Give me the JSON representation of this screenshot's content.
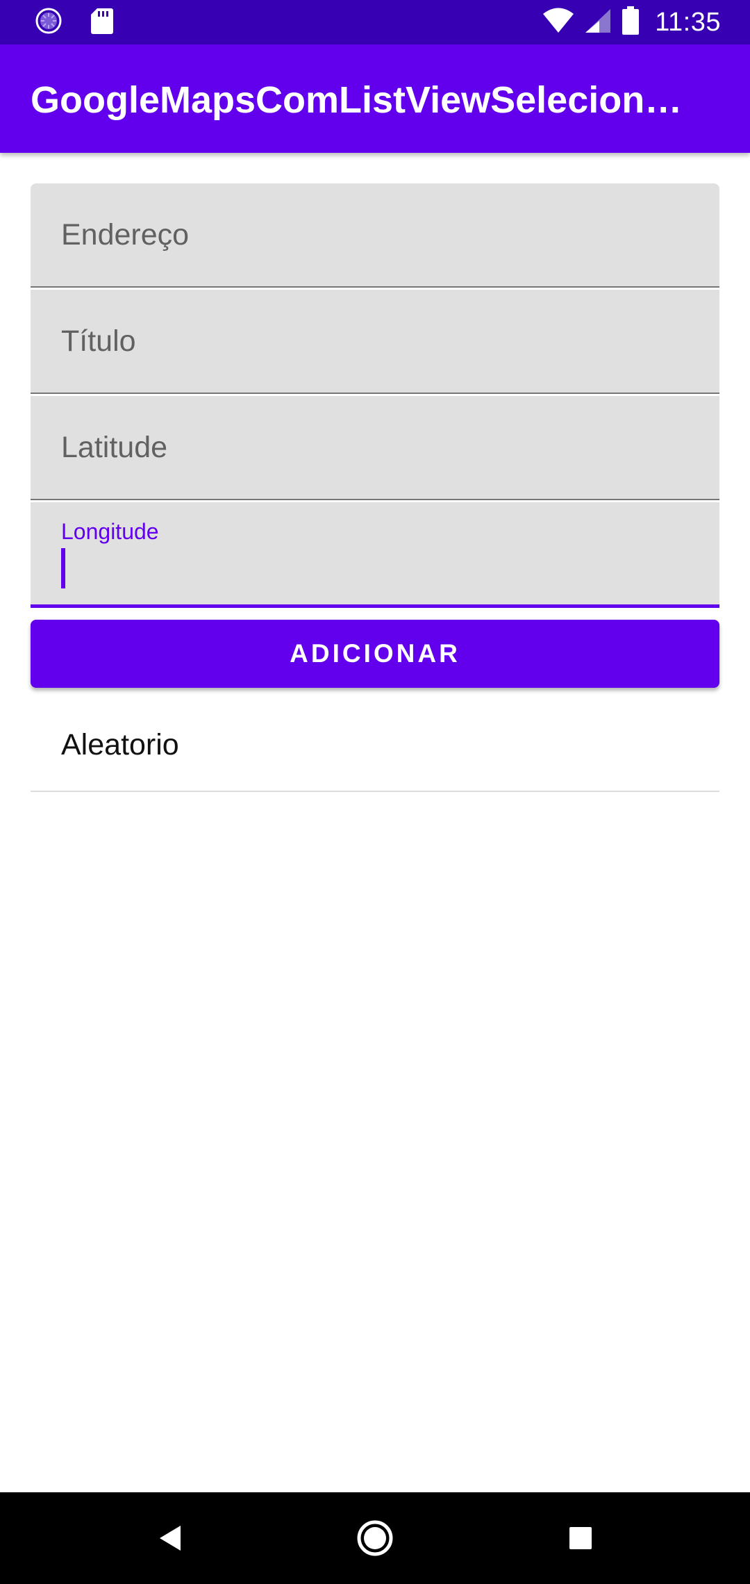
{
  "status_bar": {
    "time": "11:35",
    "left_icons": [
      "loading-circle-icon",
      "sd-card-icon"
    ],
    "right_icons": [
      "wifi-icon",
      "signal-icon",
      "battery-icon"
    ]
  },
  "app_bar": {
    "title": "GoogleMapsComListViewSeleciona…"
  },
  "form": {
    "endereco_hint": "Endereço",
    "titulo_hint": "Título",
    "latitude_hint": "Latitude",
    "longitude_label": "Longitude",
    "longitude_value": ""
  },
  "button": {
    "label": "ADICIONAR"
  },
  "list": {
    "items": [
      {
        "label": "Aleatorio"
      }
    ]
  },
  "nav_bar": {
    "icons": [
      "back-icon",
      "home-icon",
      "recents-icon"
    ]
  },
  "colors": {
    "primary": "#6200ee",
    "primary_dark": "#3700b3",
    "field_background": "#e0e0e0"
  }
}
